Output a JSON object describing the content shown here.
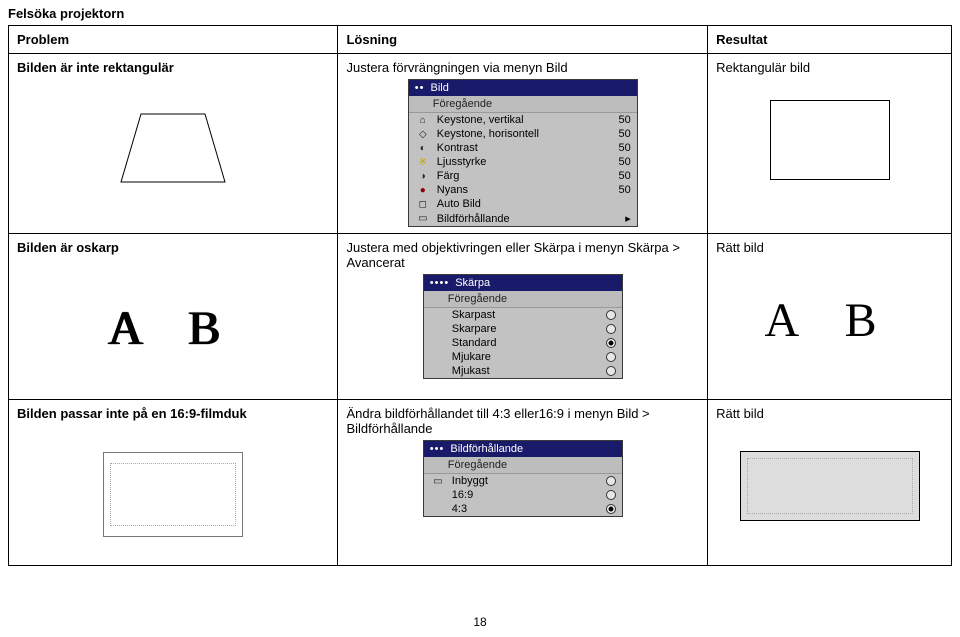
{
  "page_title": "Felsöka projektorn",
  "page_number": "18",
  "headers": {
    "problem": "Problem",
    "solution": "Lösning",
    "result": "Resultat"
  },
  "rows": [
    {
      "problem": "Bilden är inte rektangulär",
      "solution": "Justera förvrängningen via menyn Bild",
      "result": "Rektangulär bild"
    },
    {
      "problem": "Bilden är oskarp",
      "solution": "Justera med objektivringen eller Skärpa i menyn Skärpa > Avancerat",
      "result": "Rätt bild"
    },
    {
      "problem": "Bilden passar inte på en 16:9-filmduk",
      "solution": "Ändra bildförhållandet till 4:3 eller16:9 i menyn Bild > Bildförhållande",
      "result": "Rätt bild"
    }
  ],
  "menu_bild": {
    "title": "Bild",
    "subtitle": "Föregående",
    "items": [
      {
        "icon": "⌂",
        "label": "Keystone, vertikal",
        "value": "50"
      },
      {
        "icon": "◇",
        "label": "Keystone, horisontell",
        "value": "50"
      },
      {
        "icon": "◐",
        "label": "Kontrast",
        "value": "50"
      },
      {
        "icon": "※",
        "label": "Ljusstyrke",
        "value": "50"
      },
      {
        "icon": "◑",
        "label": "Färg",
        "value": "50"
      },
      {
        "icon": "●",
        "label": "Nyans",
        "value": "50"
      },
      {
        "icon": "◻",
        "label": "Auto Bild",
        "value": ""
      },
      {
        "icon": "▭",
        "label": "Bildförhållande",
        "value": "▸"
      }
    ]
  },
  "menu_skarpa": {
    "title": "Skärpa",
    "subtitle": "Föregående",
    "items": [
      {
        "label": "Skarpast",
        "selected": false
      },
      {
        "label": "Skarpare",
        "selected": false
      },
      {
        "label": "Standard",
        "selected": true
      },
      {
        "label": "Mjukare",
        "selected": false
      },
      {
        "label": "Mjukast",
        "selected": false
      }
    ]
  },
  "menu_ratio": {
    "title": "Bildförhållande",
    "subtitle": "Föregående",
    "items": [
      {
        "icon": "▭",
        "label": "Inbyggt",
        "selected": false
      },
      {
        "icon": "",
        "label": "16:9",
        "selected": false
      },
      {
        "icon": "",
        "label": "4:3",
        "selected": true
      }
    ]
  },
  "ab_text": "A B"
}
